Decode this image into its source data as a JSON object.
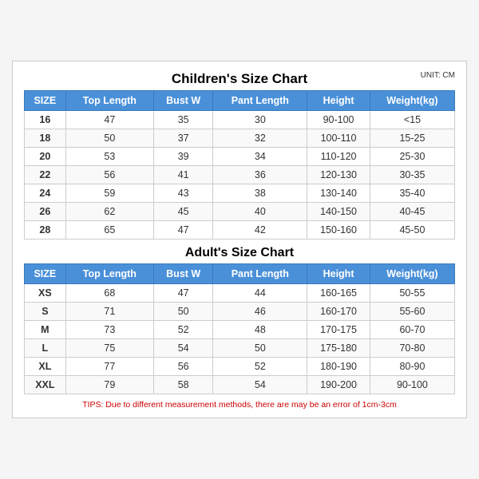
{
  "chart": {
    "unit": "UNIT: CM",
    "children": {
      "title": "Children's Size Chart",
      "headers": [
        "SIZE",
        "Top Length",
        "Bust W",
        "Pant Length",
        "Height",
        "Weight(kg)"
      ],
      "rows": [
        [
          "16",
          "47",
          "35",
          "30",
          "90-100",
          "<15"
        ],
        [
          "18",
          "50",
          "37",
          "32",
          "100-110",
          "15-25"
        ],
        [
          "20",
          "53",
          "39",
          "34",
          "110-120",
          "25-30"
        ],
        [
          "22",
          "56",
          "41",
          "36",
          "120-130",
          "30-35"
        ],
        [
          "24",
          "59",
          "43",
          "38",
          "130-140",
          "35-40"
        ],
        [
          "26",
          "62",
          "45",
          "40",
          "140-150",
          "40-45"
        ],
        [
          "28",
          "65",
          "47",
          "42",
          "150-160",
          "45-50"
        ]
      ]
    },
    "adults": {
      "title": "Adult's Size Chart",
      "headers": [
        "SIZE",
        "Top Length",
        "Bust W",
        "Pant Length",
        "Height",
        "Weight(kg)"
      ],
      "rows": [
        [
          "XS",
          "68",
          "47",
          "44",
          "160-165",
          "50-55"
        ],
        [
          "S",
          "71",
          "50",
          "46",
          "160-170",
          "55-60"
        ],
        [
          "M",
          "73",
          "52",
          "48",
          "170-175",
          "60-70"
        ],
        [
          "L",
          "75",
          "54",
          "50",
          "175-180",
          "70-80"
        ],
        [
          "XL",
          "77",
          "56",
          "52",
          "180-190",
          "80-90"
        ],
        [
          "XXL",
          "79",
          "58",
          "54",
          "190-200",
          "90-100"
        ]
      ]
    },
    "tips": "TIPS: Due to different measurement methods, there are may be an error of 1cm-3cm"
  }
}
